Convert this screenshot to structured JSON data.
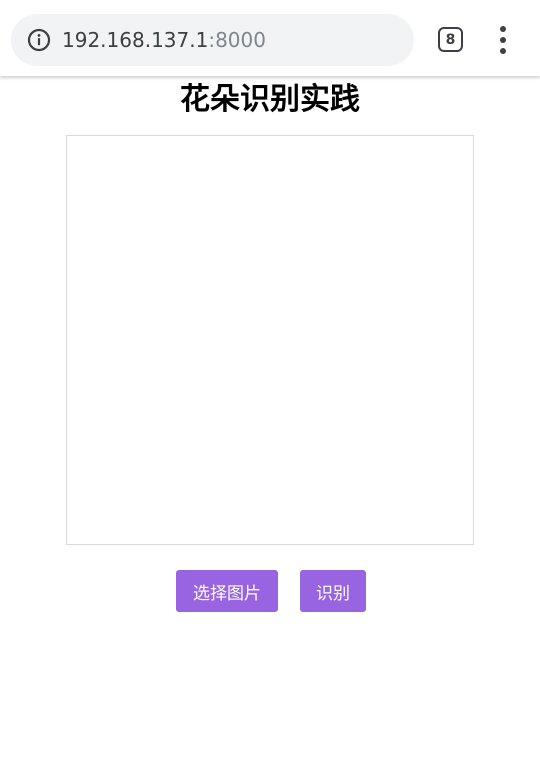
{
  "browser": {
    "url_host": "192.168.137.1",
    "url_port": ":8000",
    "tab_count": "8",
    "icons": [
      "info-icon",
      "tabs-icon",
      "more-vert-icon"
    ]
  },
  "page": {
    "title": "花朵识别实践"
  },
  "actions": {
    "choose_image_label": "选择图片",
    "recognize_label": "识别"
  },
  "colors": {
    "button_bg": "#9964e2",
    "preview_border": "#d9d9d9",
    "url_bar_bg": "#f1f3f4"
  }
}
